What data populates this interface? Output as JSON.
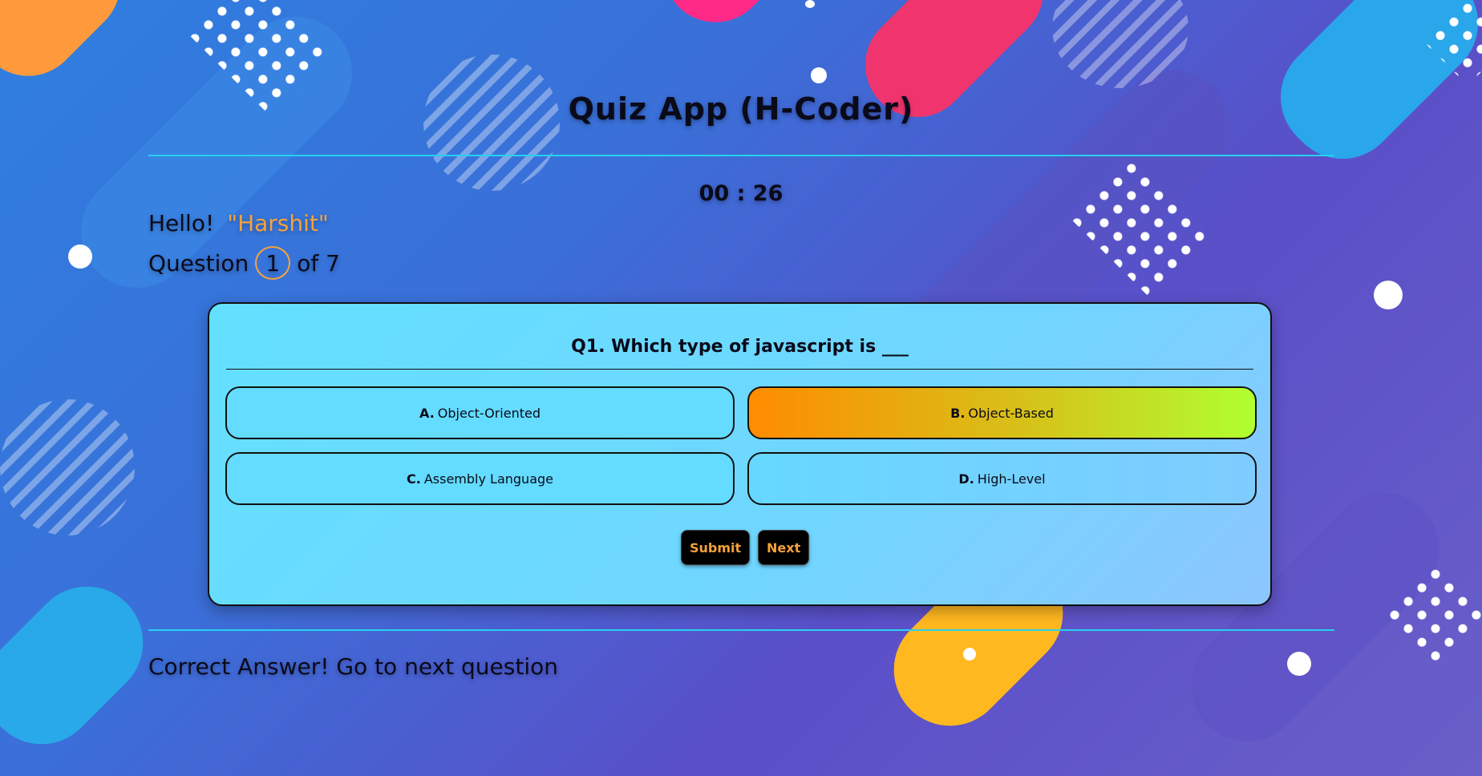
{
  "app": {
    "title": "Quiz App (H-Coder)"
  },
  "timer": {
    "value": "00 : 26"
  },
  "greeting": {
    "hello": "Hello!",
    "name": "\"Harshit\""
  },
  "progress": {
    "prefix": "Question",
    "current": "1",
    "suffix": "of 7"
  },
  "question": {
    "text": "Q1. Which type of javascript is ___"
  },
  "options": [
    {
      "letter": "A.",
      "text": "Object-Oriented",
      "selected": false
    },
    {
      "letter": "B.",
      "text": "Object-Based",
      "selected": true
    },
    {
      "letter": "C.",
      "text": "Assembly Language",
      "selected": false
    },
    {
      "letter": "D.",
      "text": "High-Level",
      "selected": false
    }
  ],
  "buttons": {
    "submit": "Submit",
    "next": "Next"
  },
  "feedback": {
    "text": "Correct Answer! Go to next question"
  },
  "colors": {
    "accent": "#f5a23a",
    "rule": "#27d0f0",
    "card": "#63e0ff",
    "selected_from": "#ff8c00",
    "selected_to": "#b0ff30"
  }
}
